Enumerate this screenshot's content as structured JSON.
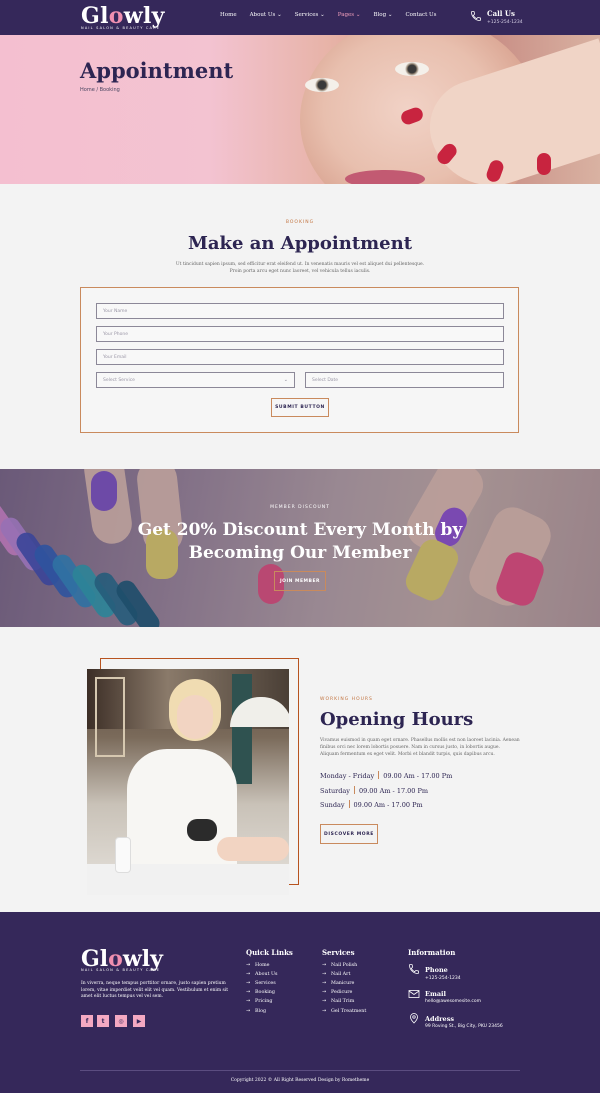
{
  "brand": {
    "name_pre": "Gl",
    "name_o": "o",
    "name_post": "wly",
    "tagline": "NAIL SALON & BEAUTY CARE",
    "accent": "#f08fb0",
    "primary": "#35285a",
    "highlight": "#c98a5d"
  },
  "nav": {
    "items": [
      {
        "label": "Home",
        "caret": ""
      },
      {
        "label": "About Us",
        "caret": "⌄"
      },
      {
        "label": "Services",
        "caret": "⌄"
      },
      {
        "label": "Pages",
        "caret": "⌄"
      },
      {
        "label": "Blog",
        "caret": "⌄"
      },
      {
        "label": "Contact Us",
        "caret": ""
      }
    ],
    "active_index": 3,
    "call_title": "Call Us",
    "call_number": "+125-254-1234"
  },
  "hero": {
    "title": "Appointment",
    "breadcrumb": "Home / Booking"
  },
  "booking": {
    "eyebrow": "BOOKING",
    "title": "Make an Appointment",
    "desc_line1": "Ut tincidunt sapien ipsum, sed efficitur erat eleifend ut. In venenatis mauris vel est aliquet dui pellentesque.",
    "desc_line2": "Proin porta arcu eget nunc laoreet, vel vehicula tellus iaculis.",
    "name_placeholder": "Your Name",
    "phone_placeholder": "Your Phone",
    "email_placeholder": "Your Email",
    "service_select": "Select Service",
    "date_placeholder": "Select Date",
    "submit_label": "SUBMIT BUTTON"
  },
  "member": {
    "eyebrow": "MEMBER DISCOUNT",
    "title_line1": "Get 20% Discount Every Month by",
    "title_line2": "Becoming Our Member",
    "button_label": "JOIN MEMBER"
  },
  "hours": {
    "eyebrow": "WORKING HOURS",
    "title": "Opening Hours",
    "text": "Vivamus euismod in quam eget ornare. Phasellus mollis est non laoreet lacinia. Aenean finibus orci nec lorem lobortis posuere. Nam in cursus justo, in lobortis augue. Aliquam fermentum ex eget velit. Morbi et blandit turpis, quis dapibus arcu.",
    "rows": [
      {
        "day": "Monday - Friday",
        "time": "09.00 Am - 17.00 Pm"
      },
      {
        "day": "Saturday",
        "time": "09.00 Am - 17.00 Pm"
      },
      {
        "day": "Sunday",
        "time": "09.00 Am - 17.00 Pm"
      }
    ],
    "button_label": "DISCOVER MORE"
  },
  "footer": {
    "about": "In viverra, neque tempus porttitor ornare, justo sapien pretium lorem, vitae imperdiet velit elit vel quam. Vestibulum et enim sit amet elit luctus tempus vel vel sem.",
    "social": [
      "f",
      "t",
      "◎",
      "▶"
    ],
    "quick_links_title": "Quick Links",
    "quick_links": [
      "Home",
      "About Us",
      "Services",
      "Booking",
      "Pricing",
      "Blog"
    ],
    "services_title": "Services",
    "services": [
      "Nail Polish",
      "Nail Art",
      "Manicure",
      "Pedicure",
      "Nail Trim",
      "Gel Treatment"
    ],
    "info_title": "Information",
    "phone_label": "Phone",
    "phone_value": "+125-254-1234",
    "email_label": "Email",
    "email_value": "hello@awesomesite.com",
    "address_label": "Address",
    "address_value": "99 Roving St., Big City, PKU 23456",
    "copyright": "Copyright 2022 © All Right Reserved Design by Rometheme"
  },
  "icons": {
    "phone": "phone-icon",
    "email": "envelope-icon",
    "address": "map-pin-icon",
    "arrow": "arrow-right-icon"
  }
}
